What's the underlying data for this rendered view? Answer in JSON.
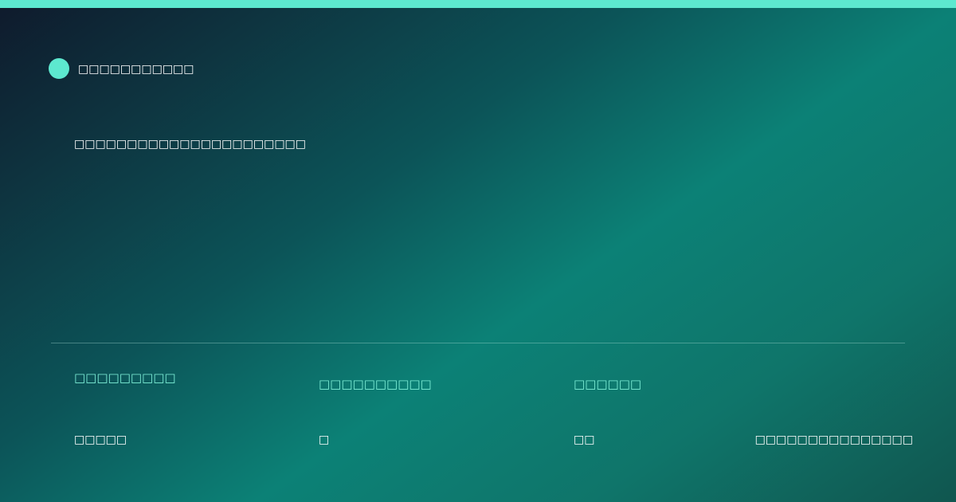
{
  "brand": {
    "name": "□□□□□□□□□□□",
    "accent_color": "#5de8cf"
  },
  "headline": "□□□□□□□□□□□□□□□□□□□□□□",
  "stats": [
    {
      "label": "□□□□□□□□□",
      "value": "□□□□□"
    },
    {
      "label": "□□□□□□□□□□",
      "value": "□"
    },
    {
      "label": "□□□□□□",
      "value": "□□"
    }
  ],
  "footer_note": "□□□□□□□□□□□□□□□",
  "colors": {
    "accent": "#5de8cf",
    "label": "#7ff0d8",
    "text": "#ffffff"
  }
}
